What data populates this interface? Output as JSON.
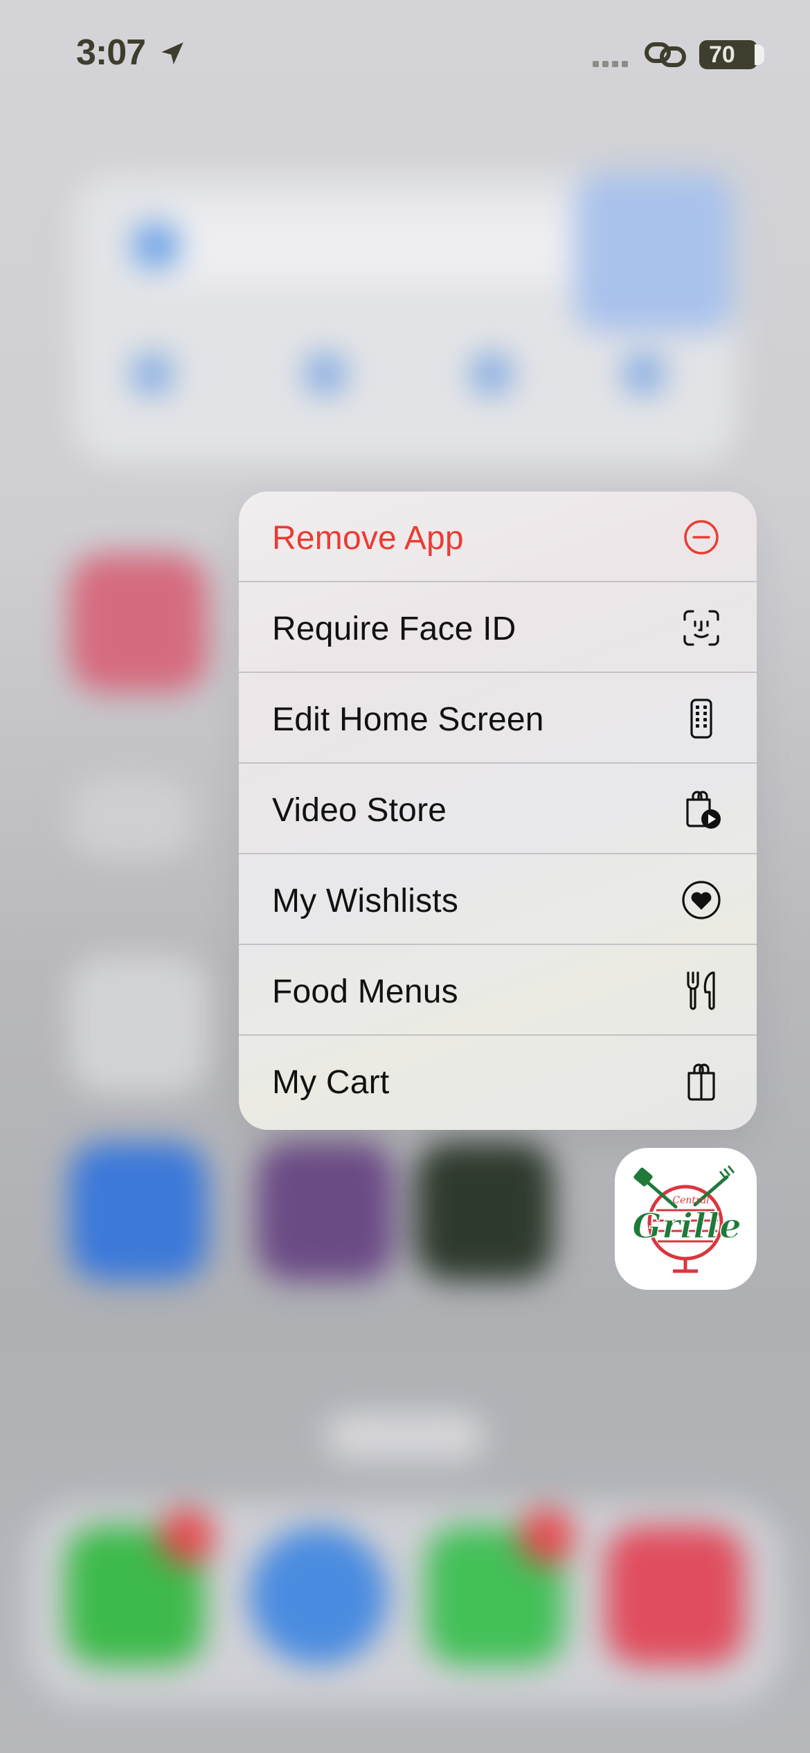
{
  "status_bar": {
    "time": "3:07",
    "battery": "70"
  },
  "context_menu": {
    "items": [
      {
        "label": "Remove App",
        "icon": "minus-circle-icon",
        "destructive": true
      },
      {
        "label": "Require Face ID",
        "icon": "face-id-icon",
        "destructive": false
      },
      {
        "label": "Edit Home Screen",
        "icon": "phone-apps-icon",
        "destructive": false
      },
      {
        "label": "Video Store",
        "icon": "bag-play-icon",
        "destructive": false
      },
      {
        "label": "My Wishlists",
        "icon": "heart-circle-icon",
        "destructive": false
      },
      {
        "label": "Food Menus",
        "icon": "fork-knife-icon",
        "destructive": false
      },
      {
        "label": "My Cart",
        "icon": "shopping-bag-icon",
        "destructive": false
      }
    ]
  },
  "app": {
    "logo_text": "Grille",
    "logo_small_text": "Central"
  },
  "colors": {
    "destructive": "#eb3b33",
    "logo_green": "#1f7a3a",
    "logo_red": "#d9363e"
  }
}
